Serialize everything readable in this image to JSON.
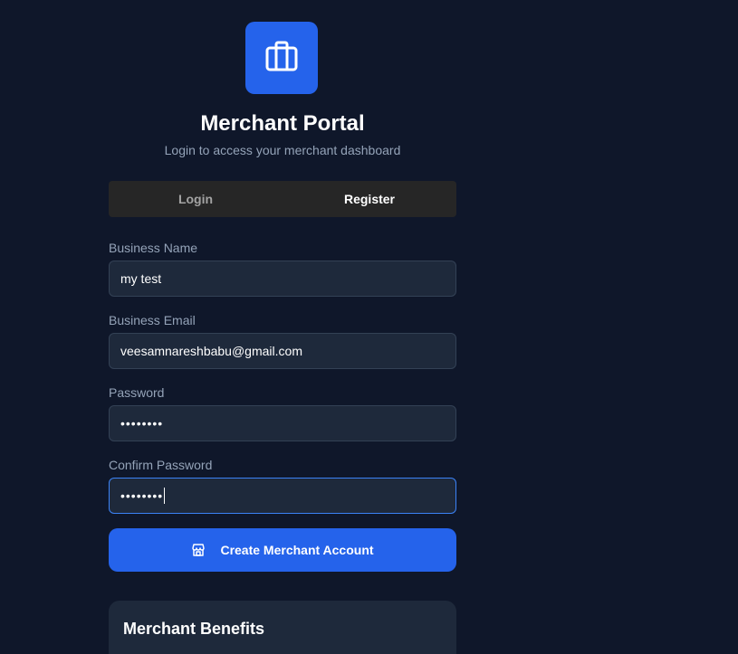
{
  "header": {
    "logo_icon": "briefcase-icon",
    "title": "Merchant Portal",
    "subtitle": "Login to access your merchant dashboard"
  },
  "tabs": [
    {
      "label": "Login",
      "active": false
    },
    {
      "label": "Register",
      "active": true
    }
  ],
  "form": {
    "business_name": {
      "label": "Business Name",
      "value": "my test"
    },
    "business_email": {
      "label": "Business Email",
      "value": "veesamnareshbabu@gmail.com"
    },
    "password": {
      "label": "Password",
      "masked": "••••••••"
    },
    "confirm_password": {
      "label": "Confirm Password",
      "masked": "••••••••",
      "focused": true
    },
    "submit": {
      "label": "Create Merchant Account",
      "icon": "store-icon"
    }
  },
  "benefits": {
    "title": "Merchant Benefits"
  },
  "colors": {
    "background": "#0f172a",
    "accent": "#2563eb",
    "input_bg": "#1e293b",
    "focus_border": "#3b82f6"
  }
}
